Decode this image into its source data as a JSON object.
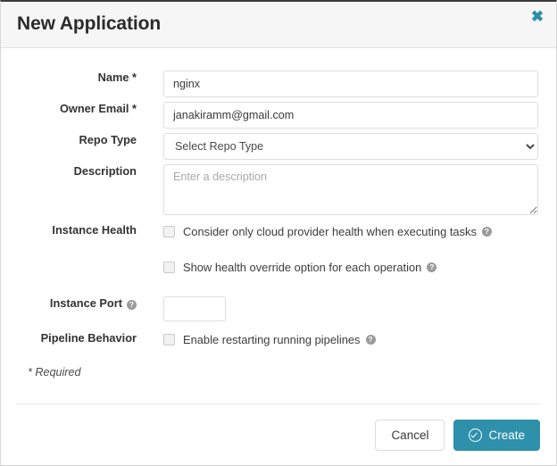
{
  "dialog": {
    "title": "New Application",
    "close_icon": "close-x-icon"
  },
  "fields": {
    "name": {
      "label": "Name *",
      "value": "nginx",
      "placeholder": ""
    },
    "owner_email": {
      "label": "Owner Email *",
      "value": "janakiramm@gmail.com",
      "placeholder": ""
    },
    "repo_type": {
      "label": "Repo Type",
      "selected": "Select Repo Type",
      "options": [
        "Select Repo Type"
      ]
    },
    "description": {
      "label": "Description",
      "value": "",
      "placeholder": "Enter a description"
    },
    "instance_health": {
      "label": "Instance Health",
      "option_cloud_provider": "Consider only cloud provider health when executing tasks",
      "option_cloud_provider_help": "?",
      "option_health_override": "Show health override option for each operation",
      "option_health_override_help": "?"
    },
    "instance_port": {
      "label": "Instance Port",
      "label_help": "?",
      "value": "",
      "placeholder": ""
    },
    "pipeline_behavior": {
      "label": "Pipeline Behavior",
      "option_restart": "Enable restarting running pipelines",
      "option_restart_help": "?"
    }
  },
  "footer": {
    "required_note": "* Required",
    "cancel_label": "Cancel",
    "create_label": "Create",
    "create_icon": "check-circle-icon"
  },
  "colors": {
    "accent": "#2e90aa",
    "header_bg": "#f6f6f6",
    "border": "#dedede",
    "text": "#333333",
    "help_icon": "#9a9a9a"
  }
}
